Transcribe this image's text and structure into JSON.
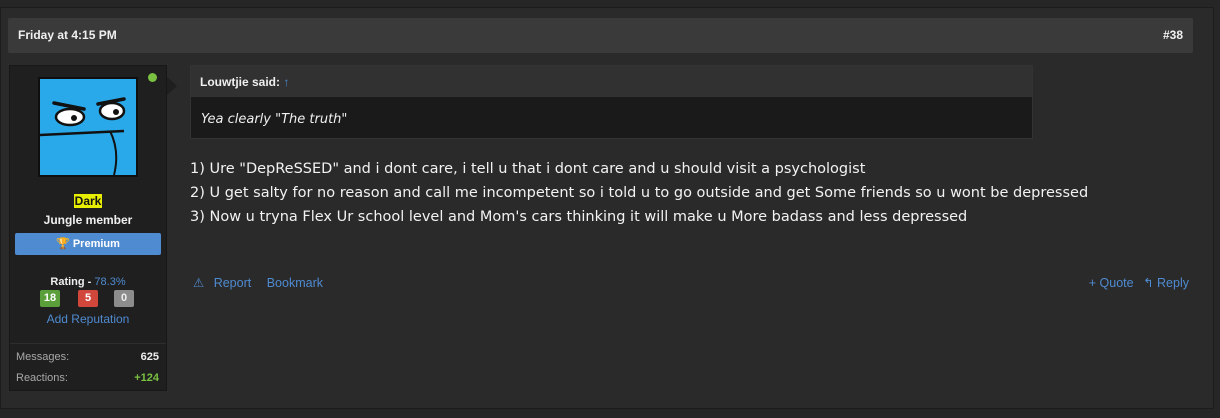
{
  "post": {
    "date": "Friday at 4:15 PM",
    "number": "#38"
  },
  "user": {
    "name": "Dark",
    "title": "Jungle member",
    "badge": "Premium",
    "rating_label": "Rating -",
    "rating_pct": "78.3%",
    "ratings": {
      "positive": "18",
      "negative": "5",
      "neutral": "0"
    },
    "add_reputation": "Add Reputation",
    "stats": [
      {
        "label": "Messages:",
        "value": "625"
      },
      {
        "label": "Reactions:",
        "value": "+124"
      }
    ]
  },
  "quote": {
    "author": "Louwtjie said:",
    "arrow": "↑",
    "text": "Yea clearly \"The truth\""
  },
  "message": {
    "lines": [
      "1) Ure \"DepReSSED\" and i dont care, i tell u that i dont care and u should visit a psychologist",
      "2) U get salty for no reason and call me incompetent so i told u to go outside and get Some friends so u wont be depressed",
      "3) Now u tryna Flex Ur school level and Mom's cars thinking it will make u More badass and less depressed"
    ]
  },
  "actions": {
    "report": "Report",
    "bookmark": "Bookmark",
    "quote": "+ Quote",
    "reply": "Reply"
  },
  "colors": {
    "accent": "#4f8bd1",
    "online": "#7ac142",
    "username_highlight": "#e8ee00"
  }
}
